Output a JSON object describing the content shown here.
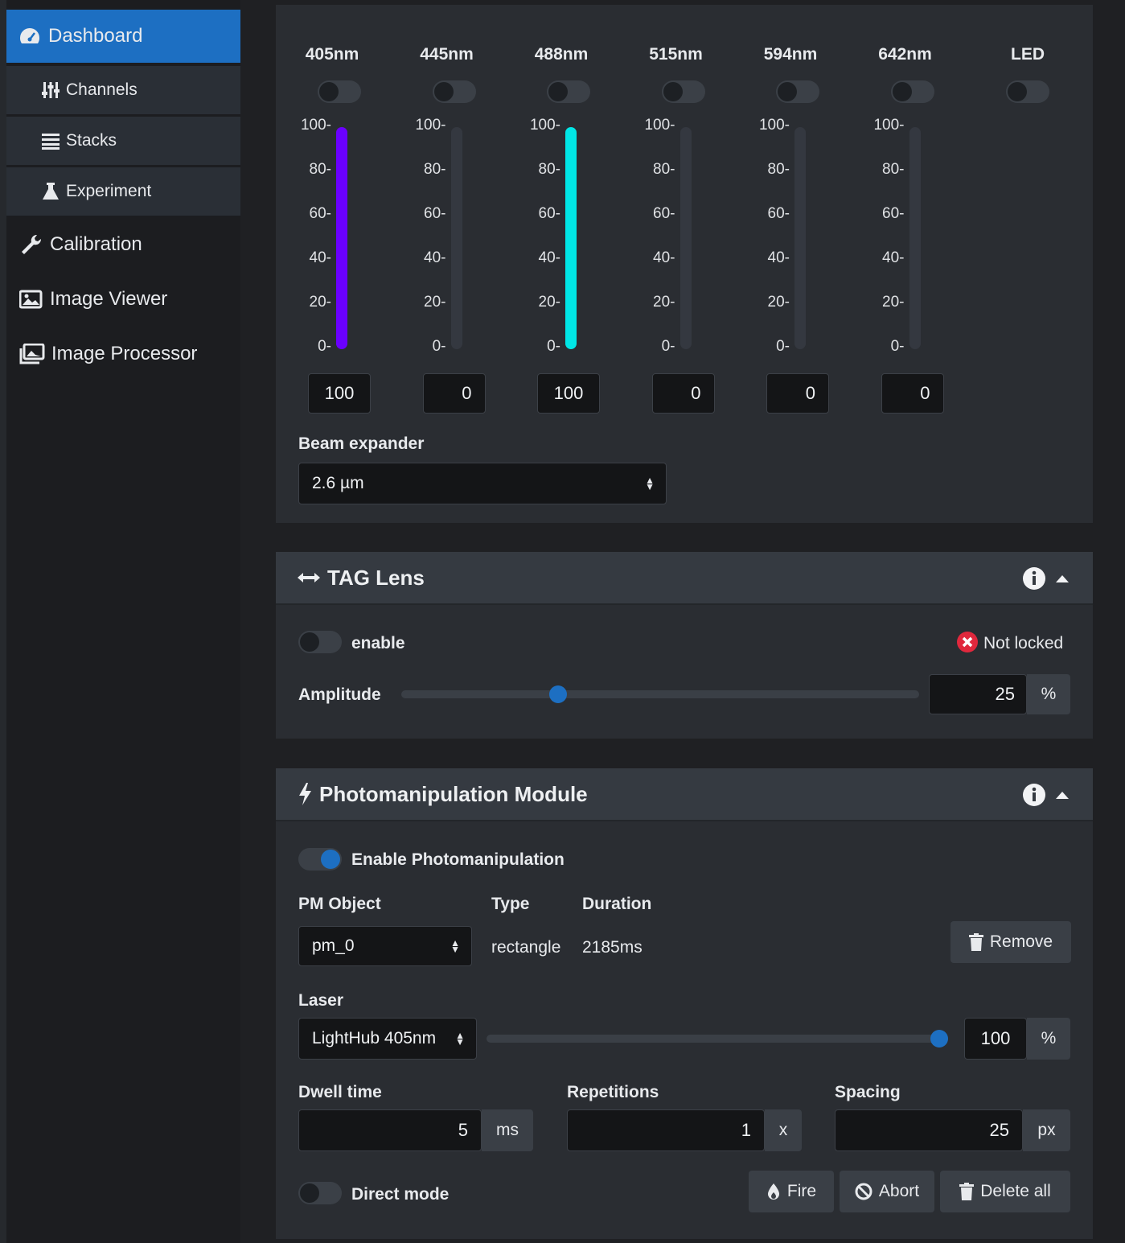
{
  "sidebar": {
    "dashboard": "Dashboard",
    "channels": "Channels",
    "stacks": "Stacks",
    "experiment": "Experiment",
    "calibration": "Calibration",
    "image_viewer": "Image Viewer",
    "image_processor": "Image Processor"
  },
  "lasers": {
    "ticks": [
      "100-",
      "80-",
      "60-",
      "40-",
      "20-",
      "0-"
    ],
    "channels": [
      {
        "label": "405nm",
        "value": "100",
        "level": 1.0,
        "color": "#6a00ff",
        "on": false
      },
      {
        "label": "445nm",
        "value": "0",
        "level": 0.0,
        "color": "#343840",
        "on": false
      },
      {
        "label": "488nm",
        "value": "100",
        "level": 1.0,
        "color": "#00e6e6",
        "on": false
      },
      {
        "label": "515nm",
        "value": "0",
        "level": 0.0,
        "color": "#343840",
        "on": false
      },
      {
        "label": "594nm",
        "value": "0",
        "level": 0.0,
        "color": "#343840",
        "on": false
      },
      {
        "label": "642nm",
        "value": "0",
        "level": 0.0,
        "color": "#343840",
        "on": false
      }
    ],
    "led_label": "LED",
    "beam_expander_label": "Beam expander",
    "beam_expander_value": "2.6 µm"
  },
  "tag_lens": {
    "title": "TAG Lens",
    "enable_label": "enable",
    "enabled": false,
    "status": "Not locked",
    "amplitude_label": "Amplitude",
    "amplitude_value": "25",
    "amplitude_unit": "%",
    "amplitude_level": 0.25
  },
  "pm": {
    "title": "Photomanipulation Module",
    "enable_label": "Enable Photomanipulation",
    "enabled": true,
    "object_label": "PM Object",
    "type_label": "Type",
    "duration_label": "Duration",
    "object_value": "pm_0",
    "type_value": "rectangle",
    "duration_value": "2185ms",
    "remove_label": "Remove",
    "laser_label": "Laser",
    "laser_value": "LightHub 405nm",
    "laser_power": "100",
    "laser_unit": "%",
    "laser_level": 1.0,
    "dwell_label": "Dwell time",
    "dwell_value": "5",
    "dwell_unit": "ms",
    "reps_label": "Repetitions",
    "reps_value": "1",
    "reps_unit": "x",
    "spacing_label": "Spacing",
    "spacing_value": "25",
    "spacing_unit": "px",
    "direct_label": "Direct mode",
    "direct_on": false,
    "fire_label": "Fire",
    "abort_label": "Abort",
    "delete_all_label": "Delete all"
  }
}
